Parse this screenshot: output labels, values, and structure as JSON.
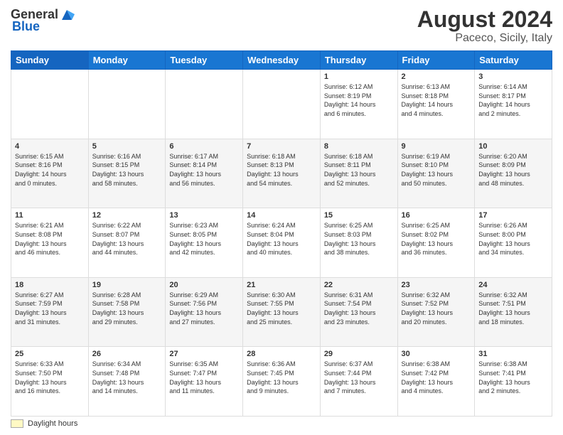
{
  "header": {
    "logo_general": "General",
    "logo_blue": "Blue",
    "title": "August 2024",
    "location": "Paceco, Sicily, Italy"
  },
  "calendar": {
    "days_of_week": [
      "Sunday",
      "Monday",
      "Tuesday",
      "Wednesday",
      "Thursday",
      "Friday",
      "Saturday"
    ],
    "weeks": [
      [
        {
          "day": "",
          "info": ""
        },
        {
          "day": "",
          "info": ""
        },
        {
          "day": "",
          "info": ""
        },
        {
          "day": "",
          "info": ""
        },
        {
          "day": "1",
          "info": "Sunrise: 6:12 AM\nSunset: 8:19 PM\nDaylight: 14 hours\nand 6 minutes."
        },
        {
          "day": "2",
          "info": "Sunrise: 6:13 AM\nSunset: 8:18 PM\nDaylight: 14 hours\nand 4 minutes."
        },
        {
          "day": "3",
          "info": "Sunrise: 6:14 AM\nSunset: 8:17 PM\nDaylight: 14 hours\nand 2 minutes."
        }
      ],
      [
        {
          "day": "4",
          "info": "Sunrise: 6:15 AM\nSunset: 8:16 PM\nDaylight: 14 hours\nand 0 minutes."
        },
        {
          "day": "5",
          "info": "Sunrise: 6:16 AM\nSunset: 8:15 PM\nDaylight: 13 hours\nand 58 minutes."
        },
        {
          "day": "6",
          "info": "Sunrise: 6:17 AM\nSunset: 8:14 PM\nDaylight: 13 hours\nand 56 minutes."
        },
        {
          "day": "7",
          "info": "Sunrise: 6:18 AM\nSunset: 8:13 PM\nDaylight: 13 hours\nand 54 minutes."
        },
        {
          "day": "8",
          "info": "Sunrise: 6:18 AM\nSunset: 8:11 PM\nDaylight: 13 hours\nand 52 minutes."
        },
        {
          "day": "9",
          "info": "Sunrise: 6:19 AM\nSunset: 8:10 PM\nDaylight: 13 hours\nand 50 minutes."
        },
        {
          "day": "10",
          "info": "Sunrise: 6:20 AM\nSunset: 8:09 PM\nDaylight: 13 hours\nand 48 minutes."
        }
      ],
      [
        {
          "day": "11",
          "info": "Sunrise: 6:21 AM\nSunset: 8:08 PM\nDaylight: 13 hours\nand 46 minutes."
        },
        {
          "day": "12",
          "info": "Sunrise: 6:22 AM\nSunset: 8:07 PM\nDaylight: 13 hours\nand 44 minutes."
        },
        {
          "day": "13",
          "info": "Sunrise: 6:23 AM\nSunset: 8:05 PM\nDaylight: 13 hours\nand 42 minutes."
        },
        {
          "day": "14",
          "info": "Sunrise: 6:24 AM\nSunset: 8:04 PM\nDaylight: 13 hours\nand 40 minutes."
        },
        {
          "day": "15",
          "info": "Sunrise: 6:25 AM\nSunset: 8:03 PM\nDaylight: 13 hours\nand 38 minutes."
        },
        {
          "day": "16",
          "info": "Sunrise: 6:25 AM\nSunset: 8:02 PM\nDaylight: 13 hours\nand 36 minutes."
        },
        {
          "day": "17",
          "info": "Sunrise: 6:26 AM\nSunset: 8:00 PM\nDaylight: 13 hours\nand 34 minutes."
        }
      ],
      [
        {
          "day": "18",
          "info": "Sunrise: 6:27 AM\nSunset: 7:59 PM\nDaylight: 13 hours\nand 31 minutes."
        },
        {
          "day": "19",
          "info": "Sunrise: 6:28 AM\nSunset: 7:58 PM\nDaylight: 13 hours\nand 29 minutes."
        },
        {
          "day": "20",
          "info": "Sunrise: 6:29 AM\nSunset: 7:56 PM\nDaylight: 13 hours\nand 27 minutes."
        },
        {
          "day": "21",
          "info": "Sunrise: 6:30 AM\nSunset: 7:55 PM\nDaylight: 13 hours\nand 25 minutes."
        },
        {
          "day": "22",
          "info": "Sunrise: 6:31 AM\nSunset: 7:54 PM\nDaylight: 13 hours\nand 23 minutes."
        },
        {
          "day": "23",
          "info": "Sunrise: 6:32 AM\nSunset: 7:52 PM\nDaylight: 13 hours\nand 20 minutes."
        },
        {
          "day": "24",
          "info": "Sunrise: 6:32 AM\nSunset: 7:51 PM\nDaylight: 13 hours\nand 18 minutes."
        }
      ],
      [
        {
          "day": "25",
          "info": "Sunrise: 6:33 AM\nSunset: 7:50 PM\nDaylight: 13 hours\nand 16 minutes."
        },
        {
          "day": "26",
          "info": "Sunrise: 6:34 AM\nSunset: 7:48 PM\nDaylight: 13 hours\nand 14 minutes."
        },
        {
          "day": "27",
          "info": "Sunrise: 6:35 AM\nSunset: 7:47 PM\nDaylight: 13 hours\nand 11 minutes."
        },
        {
          "day": "28",
          "info": "Sunrise: 6:36 AM\nSunset: 7:45 PM\nDaylight: 13 hours\nand 9 minutes."
        },
        {
          "day": "29",
          "info": "Sunrise: 6:37 AM\nSunset: 7:44 PM\nDaylight: 13 hours\nand 7 minutes."
        },
        {
          "day": "30",
          "info": "Sunrise: 6:38 AM\nSunset: 7:42 PM\nDaylight: 13 hours\nand 4 minutes."
        },
        {
          "day": "31",
          "info": "Sunrise: 6:38 AM\nSunset: 7:41 PM\nDaylight: 13 hours\nand 2 minutes."
        }
      ]
    ]
  },
  "footer": {
    "legend_label": "Daylight hours"
  }
}
